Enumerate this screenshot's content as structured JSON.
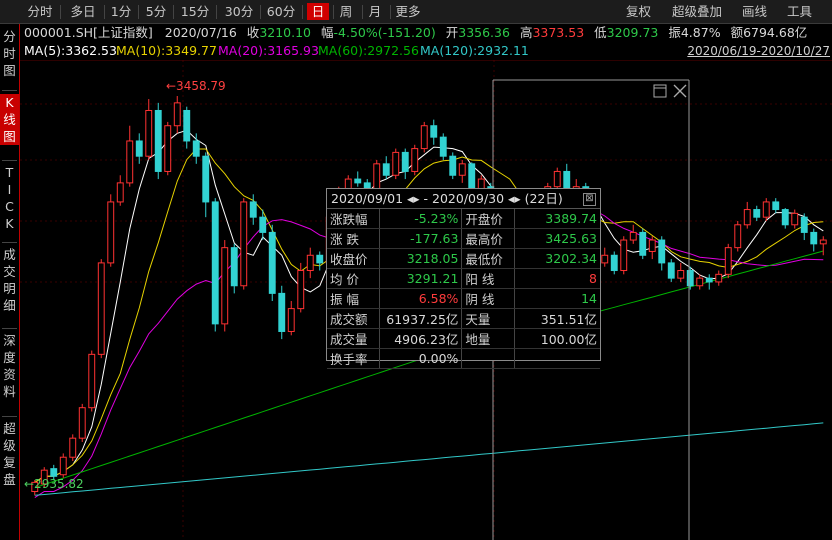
{
  "colors": {
    "up": "#ff3232",
    "down": "#32d2d2",
    "ma5": "#ffffff",
    "ma10": "#e6d200",
    "ma20": "#e000e0",
    "ma60": "#00b400",
    "ma120": "#32c8c8"
  },
  "toolbar": {
    "periods": [
      "分时",
      "多日",
      "1分",
      "5分",
      "15分",
      "30分",
      "60分",
      "日",
      "周",
      "月",
      "更多"
    ],
    "active_period": "日",
    "right_tools": [
      "复权",
      "超级叠加",
      "画线",
      "工具"
    ]
  },
  "sidebar": {
    "tabs": [
      {
        "label": "分\n时\n图",
        "active": false
      },
      {
        "label": "K\n线\n图",
        "active": true
      },
      {
        "label": "T\nI\nC\nK",
        "active": false
      },
      {
        "label": "成\n交\n明\n细",
        "active": false
      },
      {
        "label": "深\n度\n资\n料",
        "active": false
      },
      {
        "label": "超\n级\n复\n盘",
        "active": false
      }
    ]
  },
  "info": {
    "code": "000001.SH[上证指数]",
    "date": "2020/07/16",
    "close_label": "收",
    "close": "3210.10",
    "chg_label": "幅",
    "chg": "-4.50%(-151.20)",
    "open_label": "开",
    "open": "3356.36",
    "high_label": "高",
    "high": "3373.53",
    "low_label": "低",
    "low": "3209.73",
    "amp_label": "振",
    "amp": "4.87%",
    "amt_label": "额",
    "amt": "6794.68亿"
  },
  "ma": [
    {
      "text": "MA(5):3362.53",
      "color": "#ffffff"
    },
    {
      "text": "MA(10):3349.77",
      "color": "#e6d200"
    },
    {
      "text": "MA(20):3165.93",
      "color": "#e000e0"
    },
    {
      "text": "MA(60):2972.56",
      "color": "#00b400"
    },
    {
      "text": "MA(120):2932.11",
      "color": "#32c8c8"
    }
  ],
  "date_range": "2020/06/19-2020/10/27",
  "chart_data": {
    "type": "candlestick",
    "y_range": [
      2900,
      3480
    ],
    "high_label": "3458.79",
    "low_label": "2935.82",
    "candles": [
      [
        2952,
        2940,
        2955,
        2935
      ],
      [
        2968,
        2950,
        2972,
        2945
      ],
      [
        2960,
        2970,
        2975,
        2955
      ],
      [
        2985,
        2962,
        2990,
        2958
      ],
      [
        3010,
        2985,
        3015,
        2980
      ],
      [
        3050,
        3010,
        3055,
        3005
      ],
      [
        3120,
        3050,
        3125,
        3045
      ],
      [
        3240,
        3120,
        3245,
        3115
      ],
      [
        3320,
        3240,
        3330,
        3235
      ],
      [
        3345,
        3320,
        3355,
        3315
      ],
      [
        3400,
        3345,
        3420,
        3340
      ],
      [
        3380,
        3400,
        3410,
        3370
      ],
      [
        3440,
        3380,
        3455,
        3375
      ],
      [
        3360,
        3440,
        3450,
        3350
      ],
      [
        3420,
        3360,
        3425,
        3355
      ],
      [
        3450,
        3420,
        3459,
        3410
      ],
      [
        3400,
        3440,
        3445,
        3390
      ],
      [
        3380,
        3400,
        3410,
        3370
      ],
      [
        3320,
        3380,
        3385,
        3300
      ],
      [
        3160,
        3320,
        3325,
        3150
      ],
      [
        3260,
        3160,
        3270,
        3150
      ],
      [
        3210,
        3260,
        3265,
        3200
      ],
      [
        3320,
        3210,
        3325,
        3205
      ],
      [
        3300,
        3320,
        3330,
        3290
      ],
      [
        3280,
        3300,
        3310,
        3270
      ],
      [
        3200,
        3280,
        3290,
        3190
      ],
      [
        3150,
        3200,
        3210,
        3140
      ],
      [
        3180,
        3150,
        3190,
        3145
      ],
      [
        3230,
        3180,
        3240,
        3175
      ],
      [
        3250,
        3230,
        3260,
        3220
      ],
      [
        3240,
        3250,
        3255,
        3230
      ],
      [
        3300,
        3240,
        3320,
        3235
      ],
      [
        3330,
        3300,
        3340,
        3290
      ],
      [
        3350,
        3330,
        3355,
        3320
      ],
      [
        3345,
        3350,
        3360,
        3340
      ],
      [
        3330,
        3345,
        3350,
        3320
      ],
      [
        3370,
        3330,
        3375,
        3325
      ],
      [
        3355,
        3370,
        3380,
        3350
      ],
      [
        3385,
        3355,
        3390,
        3350
      ],
      [
        3360,
        3385,
        3390,
        3350
      ],
      [
        3390,
        3360,
        3395,
        3355
      ],
      [
        3420,
        3390,
        3425,
        3385
      ],
      [
        3405,
        3420,
        3428,
        3395
      ],
      [
        3380,
        3405,
        3410,
        3375
      ],
      [
        3355,
        3380,
        3385,
        3350
      ],
      [
        3370,
        3355,
        3375,
        3345
      ],
      [
        3330,
        3370,
        3372,
        3320
      ],
      [
        3350,
        3330,
        3355,
        3325
      ],
      [
        3300,
        3340,
        3345,
        3290
      ],
      [
        3280,
        3300,
        3305,
        3270
      ],
      [
        3310,
        3280,
        3315,
        3275
      ],
      [
        3240,
        3300,
        3305,
        3230
      ],
      [
        3250,
        3240,
        3255,
        3225
      ],
      [
        3280,
        3250,
        3290,
        3245
      ],
      [
        3340,
        3280,
        3345,
        3275
      ],
      [
        3360,
        3340,
        3365,
        3335
      ],
      [
        3330,
        3360,
        3370,
        3320
      ],
      [
        3340,
        3330,
        3350,
        3325
      ],
      [
        3300,
        3340,
        3345,
        3290
      ],
      [
        3240,
        3300,
        3305,
        3230
      ],
      [
        3250,
        3240,
        3260,
        3235
      ],
      [
        3230,
        3250,
        3255,
        3225
      ],
      [
        3270,
        3230,
        3275,
        3225
      ],
      [
        3280,
        3270,
        3290,
        3265
      ],
      [
        3250,
        3280,
        3285,
        3245
      ],
      [
        3270,
        3255,
        3275,
        3245
      ],
      [
        3240,
        3270,
        3275,
        3230
      ],
      [
        3220,
        3240,
        3245,
        3215
      ],
      [
        3230,
        3220,
        3240,
        3215
      ],
      [
        3210,
        3230,
        3235,
        3205
      ],
      [
        3220,
        3210,
        3225,
        3205
      ],
      [
        3215,
        3220,
        3225,
        3205
      ],
      [
        3225,
        3215,
        3230,
        3210
      ],
      [
        3260,
        3225,
        3265,
        3220
      ],
      [
        3290,
        3260,
        3295,
        3255
      ],
      [
        3310,
        3290,
        3320,
        3285
      ],
      [
        3300,
        3310,
        3315,
        3295
      ],
      [
        3320,
        3300,
        3325,
        3295
      ],
      [
        3310,
        3320,
        3325,
        3305
      ],
      [
        3290,
        3310,
        3312,
        3285
      ],
      [
        3305,
        3290,
        3310,
        3285
      ],
      [
        3280,
        3300,
        3305,
        3270
      ],
      [
        3265,
        3280,
        3285,
        3255
      ],
      [
        3270,
        3265,
        3275,
        3250
      ]
    ]
  },
  "panel": {
    "title": "2020/09/01 ◂▸ - 2020/09/30 ◂▸  (22日)",
    "rows": [
      {
        "l1": "涨跌幅",
        "v1": "-5.23%",
        "c1": "g",
        "l2": "开盘价",
        "v2": "3389.74",
        "c2": "g"
      },
      {
        "l1": "涨  跌",
        "v1": "-177.63",
        "c1": "g",
        "l2": "最高价",
        "v2": "3425.63",
        "c2": "g"
      },
      {
        "l1": "收盘价",
        "v1": "3218.05",
        "c1": "g",
        "l2": "最低价",
        "v2": "3202.34",
        "c2": "g"
      },
      {
        "l1": "均  价",
        "v1": "3291.21",
        "c1": "g",
        "l2": "阳  线",
        "v2": "8",
        "c2": "r"
      },
      {
        "l1": "振  幅",
        "v1": "6.58%",
        "c1": "r",
        "l2": "阴  线",
        "v2": "14",
        "c2": "g"
      },
      {
        "l1": "成交额",
        "v1": "61937.25亿",
        "c1": "w",
        "l2": "天量",
        "v2": "351.51亿",
        "c2": "w"
      },
      {
        "l1": "成交量",
        "v1": "4906.23亿",
        "c1": "w",
        "l2": "地量",
        "v2": "100.00亿",
        "c2": "w"
      },
      {
        "l1": "换手率",
        "v1": "0.00%",
        "c1": "w",
        "l2": "",
        "v2": "",
        "c2": "w"
      }
    ]
  }
}
